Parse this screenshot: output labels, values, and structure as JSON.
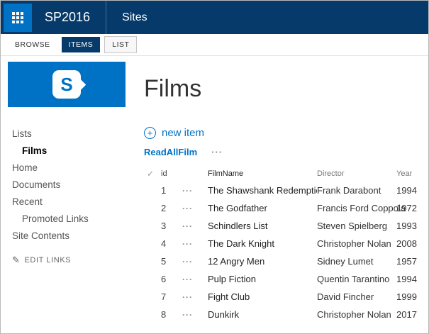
{
  "colors": {
    "suite_bar_bg": "#063a6a",
    "accent_blue": "#0072c6",
    "link_blue": "#0072c6"
  },
  "suite_bar": {
    "app_title": "SP2016",
    "section": "Sites"
  },
  "ribbon": {
    "tabs": [
      "BROWSE",
      "ITEMS",
      "LIST"
    ]
  },
  "logo": {
    "letter": "S"
  },
  "sidebar": {
    "items": [
      "Lists",
      "Films",
      "Home",
      "Documents",
      "Recent",
      "Promoted Links",
      "Site Contents"
    ],
    "edit_links_label": "EDIT LINKS"
  },
  "icons": {
    "checkmark": "✓",
    "ellipsis": "···",
    "pencil": "✎",
    "plus": "+"
  },
  "main": {
    "page_title": "Films",
    "new_item_label": "new item",
    "view_label": "ReadAllFilm",
    "table": {
      "columns": {
        "id": "id",
        "film": "FilmName",
        "director": "Director",
        "year": "Year"
      },
      "rows": [
        {
          "id": "1",
          "film": "The Shawshank Redemption",
          "director": "Frank Darabont",
          "year": "1994"
        },
        {
          "id": "2",
          "film": "The Godfather",
          "director": "Francis Ford Coppola",
          "year": "1972"
        },
        {
          "id": "3",
          "film": "Schindlers List",
          "director": "Steven Spielberg",
          "year": "1993"
        },
        {
          "id": "4",
          "film": "The Dark Knight",
          "director": "Christopher Nolan",
          "year": "2008"
        },
        {
          "id": "5",
          "film": "12 Angry Men",
          "director": "Sidney Lumet",
          "year": "1957"
        },
        {
          "id": "6",
          "film": "Pulp Fiction",
          "director": "Quentin Tarantino",
          "year": "1994"
        },
        {
          "id": "7",
          "film": "Fight Club",
          "director": "David Fincher",
          "year": "1999"
        },
        {
          "id": "8",
          "film": "Dunkirk",
          "director": "Christopher Nolan",
          "year": "2017"
        }
      ]
    }
  }
}
